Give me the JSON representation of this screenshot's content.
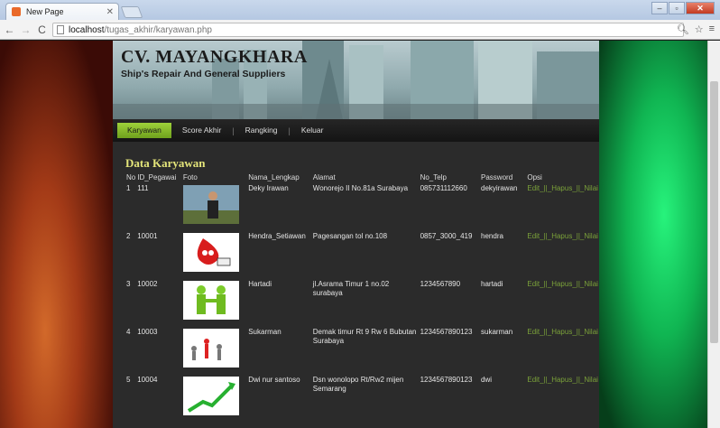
{
  "browser": {
    "tab_title": "New Page",
    "url_host": "localhost",
    "url_path": "/tugas_akhir/karyawan.php"
  },
  "header": {
    "title": "CV. MAYANGKHARA",
    "subtitle": "Ship's Repair And General Suppliers"
  },
  "menu": {
    "items": [
      {
        "label": "Karyawan"
      },
      {
        "label": "Score Akhir"
      },
      {
        "label": "Rangking"
      },
      {
        "label": "Keluar"
      }
    ]
  },
  "section_title": "Data Karyawan",
  "table": {
    "columns": [
      "No",
      "ID_Pegawai",
      "Foto",
      "Nama_Lengkap",
      "Alamat",
      "No_Telp",
      "Password",
      "Opsi"
    ],
    "rows": [
      {
        "no": "1",
        "id": "111",
        "photo": "man-photo",
        "nama": "Deky Irawan",
        "alamat": "Wonorejo II No.81a Surabaya",
        "telp": "085731112660",
        "password": "dekyirawan",
        "opsi": "Edit_||_Hapus_||_Nilai"
      },
      {
        "no": "2",
        "id": "10001",
        "photo": "blood-drop-cartoon",
        "nama": "Hendra_Setiawan",
        "alamat": "Pagesangan tol no.108",
        "telp": "0857_3000_419",
        "password": "hendra",
        "opsi": "Edit_||_Hapus_||_Nilai"
      },
      {
        "no": "3",
        "id": "10002",
        "photo": "handshake-figures",
        "nama": "Hartadi",
        "alamat": "jl.Asrama Timur 1 no.02 surabaya",
        "telp": "1234567890",
        "password": "hartadi",
        "opsi": "Edit_||_Hapus_||_Nilai"
      },
      {
        "no": "4",
        "id": "10003",
        "photo": "team-figures",
        "nama": "Sukarman",
        "alamat": "Demak timur Rt 9 Rw 6 Bubutan Surabaya",
        "telp": "1234567890123",
        "password": "sukarman",
        "opsi": "Edit_||_Hapus_||_Nilai"
      },
      {
        "no": "5",
        "id": "10004",
        "photo": "growth-arrow",
        "nama": "Dwi nur santoso",
        "alamat": "Dsn wonolopo Rt/Rw2 mijen Semarang",
        "telp": "1234567890123",
        "password": "dwi",
        "opsi": "Edit_||_Hapus_||_Nilai"
      }
    ]
  }
}
